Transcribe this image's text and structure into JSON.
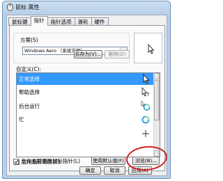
{
  "window": {
    "title": "鼠标 属性"
  },
  "tabs": [
    {
      "label": "鼠标键",
      "active": false
    },
    {
      "label": "指针",
      "active": true
    },
    {
      "label": "指针选项",
      "active": false
    },
    {
      "label": "滑轮",
      "active": false
    },
    {
      "label": "硬件",
      "active": false
    }
  ],
  "scheme": {
    "group_label": "方案(S)",
    "selected": "Windows Aero （系统方案）",
    "save_as_label": "另存为(V)...",
    "delete_label": "删除(D)"
  },
  "customize": {
    "label": "自定义(C):",
    "rows": [
      {
        "label": "正常选择",
        "icon": "arrow-cursor-icon",
        "selected": true
      },
      {
        "label": "帮助选择",
        "icon": "help-cursor-icon",
        "selected": false
      },
      {
        "label": "后台运行",
        "icon": "working-cursor-icon",
        "selected": false
      },
      {
        "label": "忙",
        "icon": "busy-cursor-icon",
        "selected": false
      },
      {
        "label": "",
        "icon": "precision-cursor-icon",
        "selected": false
      }
    ]
  },
  "options": {
    "shadow_label": "启用指针阴影(E)",
    "shadow_checked": true,
    "theme_label": "允许主题更改鼠标指针(L)",
    "theme_checked": true,
    "use_default_label": "使用默认值(F)",
    "browse_label": "浏览(B)..."
  },
  "dialog_buttons": {
    "ok_label": "确定",
    "cancel_label": "取消",
    "apply_label": "应用(A)"
  },
  "colors": {
    "selection": "#3399ff",
    "annotation": "#d41f1f",
    "window_frame": "#b9d0e8"
  }
}
